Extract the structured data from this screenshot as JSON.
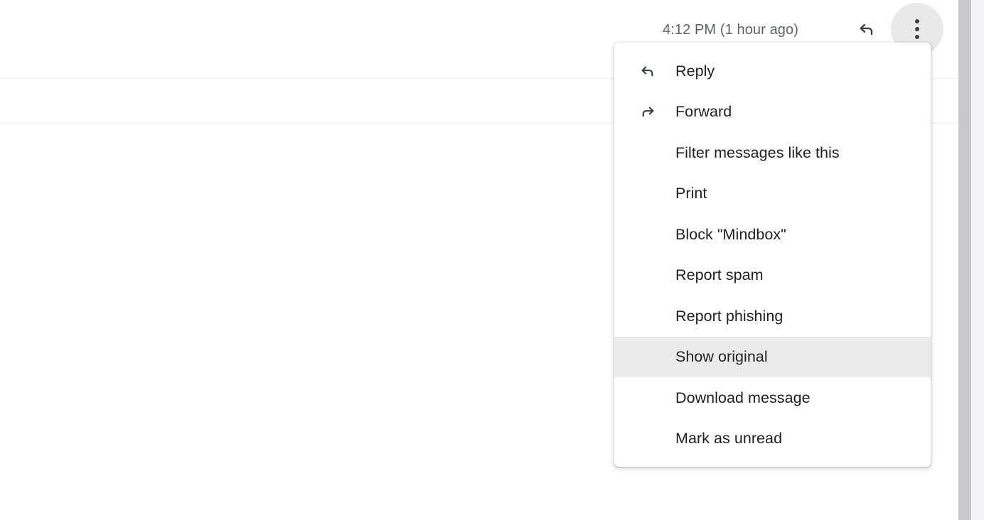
{
  "message_header": {
    "timestamp": "4:12 PM (1 hour ago)",
    "reply_icon": "reply-arrow-icon",
    "more_icon": "more-vertical-icon"
  },
  "menu": {
    "name": "message-more-options-menu",
    "highlighted_item": "Show original",
    "items": [
      {
        "label": "Reply",
        "icon": "reply-arrow-icon",
        "has_icon": true,
        "highlighted": false
      },
      {
        "label": "Forward",
        "icon": "forward-arrow-icon",
        "has_icon": true,
        "highlighted": false
      },
      {
        "label": "Filter messages like this",
        "icon": "",
        "has_icon": false,
        "highlighted": false
      },
      {
        "label": "Print",
        "icon": "",
        "has_icon": false,
        "highlighted": false
      },
      {
        "label": "Block \"Mindbox\"",
        "icon": "",
        "has_icon": false,
        "highlighted": false
      },
      {
        "label": "Report spam",
        "icon": "",
        "has_icon": false,
        "highlighted": false
      },
      {
        "label": "Report phishing",
        "icon": "",
        "has_icon": false,
        "highlighted": false
      },
      {
        "label": "Show original",
        "icon": "",
        "has_icon": false,
        "highlighted": true
      },
      {
        "label": "Download message",
        "icon": "",
        "has_icon": false,
        "highlighted": false
      },
      {
        "label": "Mark as unread",
        "icon": "",
        "has_icon": false,
        "highlighted": false
      }
    ]
  },
  "scrollbar": {
    "name": "vertical-scrollbar",
    "thumb_color": "#c9c9c9",
    "track_color": "#f5f5f9"
  },
  "colors": {
    "menu_background": "#ffffff",
    "highlight": "#ebebeb",
    "text_primary": "#202124",
    "text_secondary": "#5f6368",
    "divider": "#eceff1",
    "more_button_background": "#e9e9e9"
  }
}
